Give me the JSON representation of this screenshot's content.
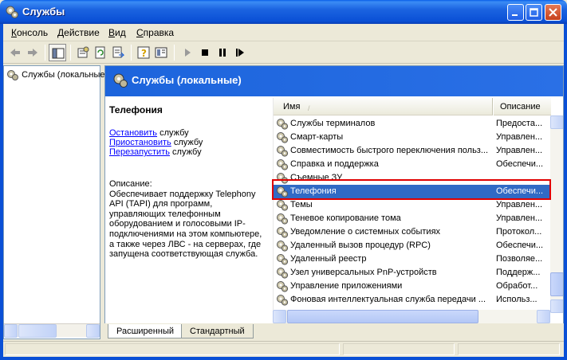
{
  "window": {
    "title": "Службы",
    "controls": [
      "minimize",
      "maximize",
      "close"
    ]
  },
  "menu": {
    "items": [
      {
        "pre": "",
        "u": "К",
        "post": "онсоль"
      },
      {
        "pre": "",
        "u": "Д",
        "post": "ействие"
      },
      {
        "pre": "",
        "u": "В",
        "post": "ид"
      },
      {
        "pre": "",
        "u": "С",
        "post": "правка"
      }
    ]
  },
  "toolbar": {
    "icons": [
      "back-icon",
      "forward-icon",
      "show-hide-tree-icon",
      "properties-icon",
      "refresh-icon",
      "export-list-icon",
      "help-icon",
      "view-icon",
      "start-icon",
      "stop-icon",
      "pause-icon",
      "restart-icon"
    ]
  },
  "tree": {
    "root_label": "Службы (локальные"
  },
  "banner": {
    "title": "Службы (локальные)"
  },
  "extended": {
    "title": "Телефония",
    "actions": [
      {
        "link": "Остановить",
        "rest": " службу"
      },
      {
        "link": "Приостановить",
        "rest": " службу"
      },
      {
        "link": "Перезапустить",
        "rest": " службу"
      }
    ],
    "description_label": "Описание:",
    "description_lines": [
      "Обеспечивает поддержку Telephony",
      "API (TAPI) для программ,",
      "управляющих телефонным",
      "оборудованием и голосовыми IP-",
      "подключениями на этом компьютере,",
      "а также через ЛВС - на серверах, где",
      "запущена соответствующая служба."
    ]
  },
  "list": {
    "columns": {
      "name": "Имя",
      "sort_indicator": "/",
      "description": "Описание"
    },
    "rows": [
      {
        "name": "Службы терминалов",
        "desc": "Предоста..."
      },
      {
        "name": "Смарт-карты",
        "desc": "Управлен..."
      },
      {
        "name": "Совместимость быстрого переключения польз...",
        "desc": "Управлен..."
      },
      {
        "name": "Справка и поддержка",
        "desc": "Обеспечи..."
      },
      {
        "name": "Съемные ЗУ",
        "desc": ""
      },
      {
        "name": "Телефония",
        "desc": "Обеспечи...",
        "selected": true
      },
      {
        "name": "Темы",
        "desc": "Управлен..."
      },
      {
        "name": "Теневое копирование тома",
        "desc": "Управлен..."
      },
      {
        "name": "Уведомление о системных событиях",
        "desc": "Протокол..."
      },
      {
        "name": "Удаленный вызов процедур (RPC)",
        "desc": "Обеспечи..."
      },
      {
        "name": "Удаленный реестр",
        "desc": "Позволяе..."
      },
      {
        "name": "Узел универсальных PnP-устройств",
        "desc": "Поддерж..."
      },
      {
        "name": "Управление приложениями",
        "desc": "Обработ..."
      },
      {
        "name": "Фоновая интеллектуальная служба передачи ...",
        "desc": "Использ..."
      }
    ]
  },
  "tabs": {
    "extended": "Расширенный",
    "standard": "Стандартный"
  }
}
